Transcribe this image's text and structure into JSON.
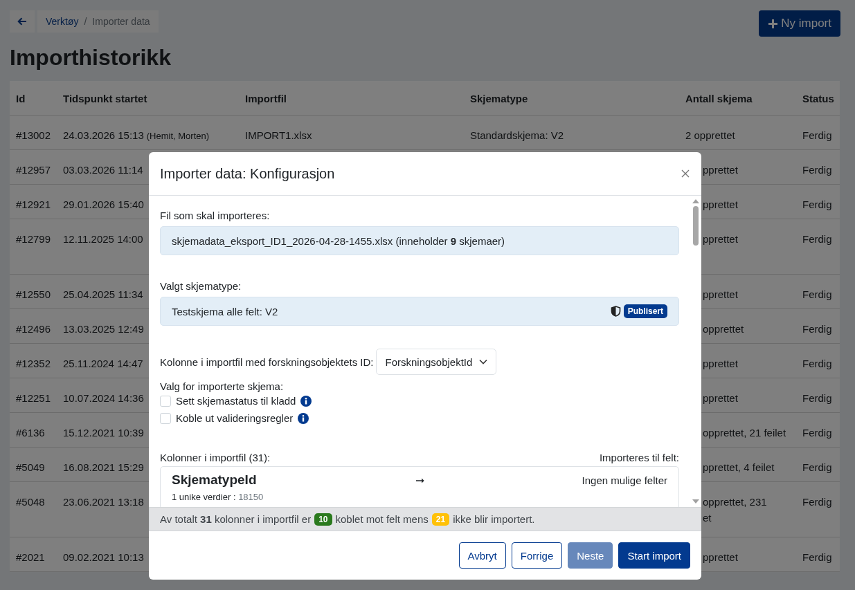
{
  "breadcrumb": {
    "items": [
      "Verktøy",
      "Importer data"
    ],
    "separator": "/"
  },
  "new_import_button": "Ny import",
  "title": "Importhistorikk",
  "table": {
    "columns": [
      "Id",
      "Tidspunkt startet",
      "Importfil",
      "Skjematype",
      "Antall skjema",
      "Status"
    ],
    "rows": [
      {
        "id": "#13002",
        "started": "24.03.2026 15:13",
        "user": "(Hemit, Morten)",
        "importfil": "IMPORT1.xlsx",
        "skjematype": "Standardskjema: V2",
        "antall": [
          "2 opprettet"
        ],
        "status": "Ferdig",
        "tall": false
      },
      {
        "id": "#12957",
        "started": "03.03.2026 11:14",
        "antall": [
          "pprettet"
        ],
        "status": "Ferdig",
        "tall": false
      },
      {
        "id": "#12921",
        "started": "29.01.2026 15:40",
        "antall": [
          "pprettet"
        ],
        "status": "Ferdig",
        "tall": false
      },
      {
        "id": "#12799",
        "started": "12.11.2025 14:00",
        "antall": [
          "pprettet"
        ],
        "status": "Ferdig",
        "tall": true
      },
      {
        "id": "#12550",
        "started": "25.04.2025 11:34",
        "antall": [
          "pprettet"
        ],
        "status": "Ferdig",
        "tall": false
      },
      {
        "id": "#12496",
        "started": "13.03.2025 12:49",
        "antall": [
          "opprettet"
        ],
        "status": "Ferdig",
        "tall": false
      },
      {
        "id": "#12352",
        "started": "25.11.2024 14:47",
        "antall": [
          "pprettet"
        ],
        "status": "Ferdig",
        "tall": false
      },
      {
        "id": "#12251",
        "started": "10.07.2024 14:36",
        "antall": [
          "pprettet"
        ],
        "status": "Ferdig",
        "tall": false
      },
      {
        "id": "#6136",
        "started": "15.12.2021 10:39",
        "antall": [
          "opprettet, 21 feilet"
        ],
        "status": "Ferdig",
        "tall": false
      },
      {
        "id": "#5049",
        "started": "16.08.2021 15:29",
        "antall": [
          "pprettet, 4 feilet"
        ],
        "status": "Ferdig",
        "tall": false
      },
      {
        "id": "#5048",
        "started": "23.06.2021 13:18",
        "antall": [
          "opprettet, 231",
          "et"
        ],
        "status": "Ferdig",
        "tall": true
      },
      {
        "id": "#2021",
        "started": "09.02.2021 10:13",
        "antall": [
          "pprettet"
        ],
        "status": "Ferdig",
        "tall": false
      }
    ]
  },
  "modal": {
    "title": "Importer data: Konfigurasjon",
    "file_label": "Fil som skal importeres:",
    "file_value": "skjemadata_eksport_ID1_2026-04-28-1455.xlsx (inneholder **9** skjemaer)",
    "schema_label": "Valgt skjematype:",
    "schema_value": "Testskjema alle felt: V2",
    "schema_badge": "Publisert",
    "id_column_label": "Kolonne i importfil med forskningsobjektets ID:",
    "id_column_select": "ForskningsobjektId",
    "options_label": "Valg for importerte skjema:",
    "options": [
      {
        "label": "Sett skjemastatus til kladd",
        "checked": false
      },
      {
        "label": "Koble ut valideringsregler",
        "checked": false
      }
    ],
    "columns_label": "Kolonner i importfil (31):",
    "target_label": "Importeres til felt:",
    "mappings": [
      {
        "column": "SkjematypeId",
        "unique_label": "1 unike verdier :",
        "unique_values": "18150",
        "arrow": "➞",
        "target": "Ingen mulige felter"
      }
    ],
    "summary": [
      {
        "kind": "text",
        "text": "Av totalt **31** kolonner i importfil er"
      },
      {
        "kind": "badge",
        "text": "10",
        "color": "#2b7a1e"
      },
      {
        "kind": "text",
        "text": "koblet mot felt mens"
      },
      {
        "kind": "badge",
        "text": "21",
        "color": "#ffc107"
      },
      {
        "kind": "text",
        "text": "ikke blir importert."
      }
    ],
    "buttons": [
      {
        "label": "Avbryt",
        "kind": "outline",
        "disabled": false
      },
      {
        "label": "Forrige",
        "kind": "outline",
        "disabled": false
      },
      {
        "label": "Neste",
        "kind": "primary",
        "disabled": true
      },
      {
        "label": "Start import",
        "kind": "primary",
        "disabled": false
      }
    ]
  }
}
